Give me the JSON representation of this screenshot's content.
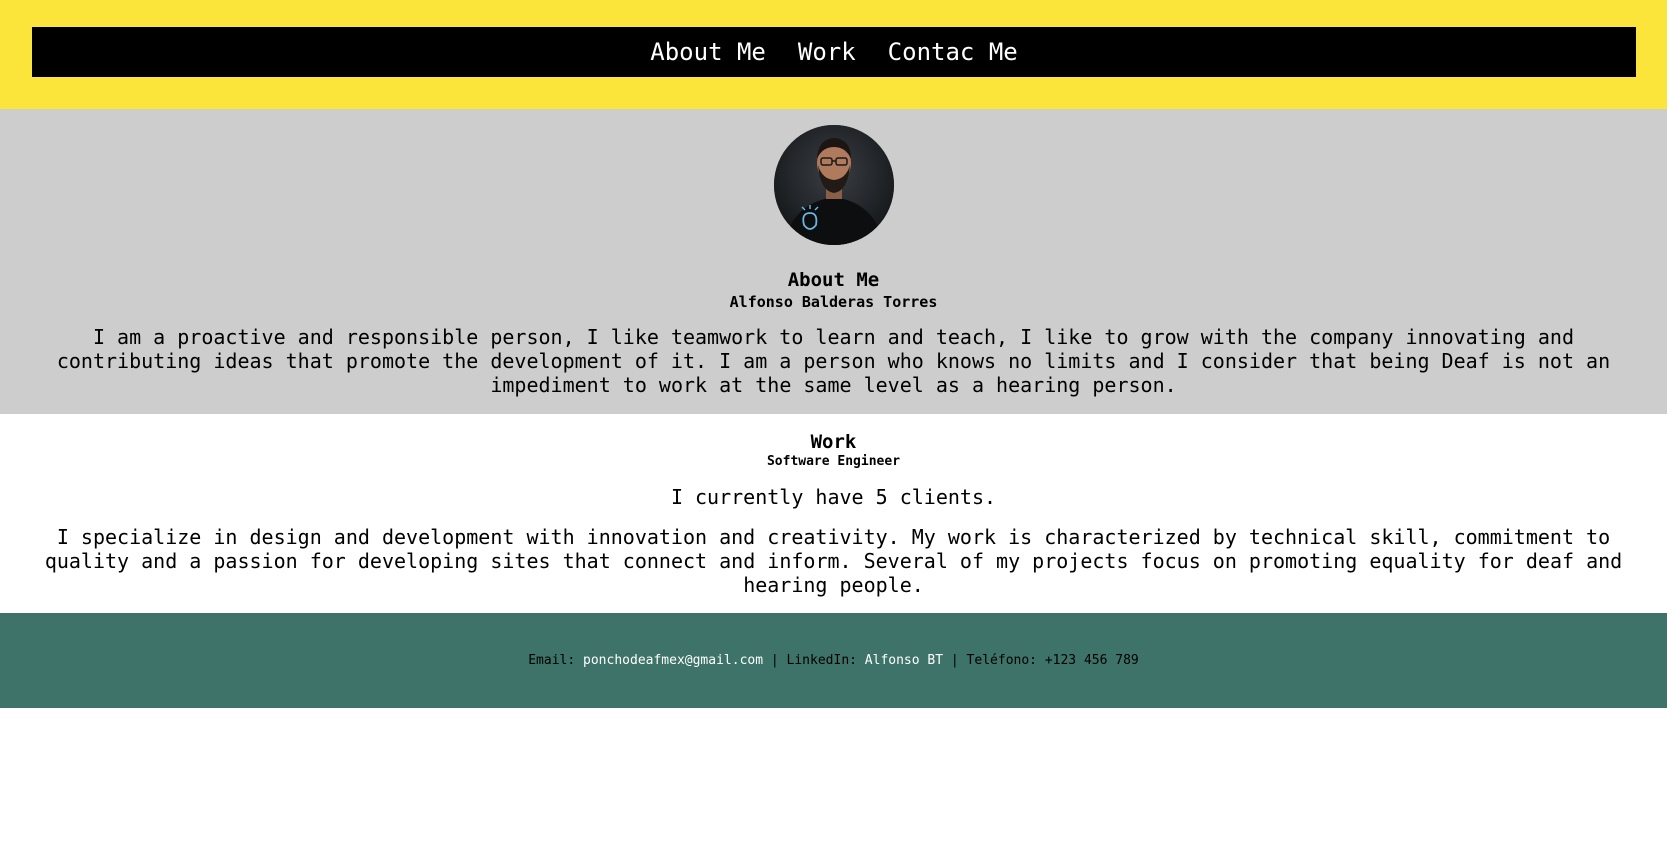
{
  "nav": {
    "items": [
      "About Me",
      "Work",
      "Contac Me"
    ]
  },
  "about": {
    "title": "About Me",
    "name": "Alfonso Balderas Torres",
    "text": "I am a proactive and responsible person, I like teamwork to learn and teach, I like to grow with the company innovating and contributing ideas that promote the development of it. I am a person who knows no limits and I consider that being Deaf is not an impediment to work at the same level as a hearing person."
  },
  "work": {
    "title": "Work",
    "role": "Software Engineer",
    "clients": "I currently have 5 clients.",
    "text": "I specialize in design and development with innovation and creativity. My work is characterized by technical skill, commitment to quality and a passion for developing sites that connect and inform. Several of my projects focus on promoting equality for deaf and hearing people."
  },
  "footer": {
    "email_label": "Email: ",
    "email": "ponchodeafmex@gmail.com",
    "sep1": " | LinkedIn: ",
    "linkedin": "Alfonso BT",
    "sep2": " | Teléfono: +123 456 789"
  },
  "colors": {
    "header_bg": "#fbe53b",
    "nav_bg": "#000000",
    "about_bg": "#cdcdcd",
    "footer_bg": "#3d7368"
  }
}
